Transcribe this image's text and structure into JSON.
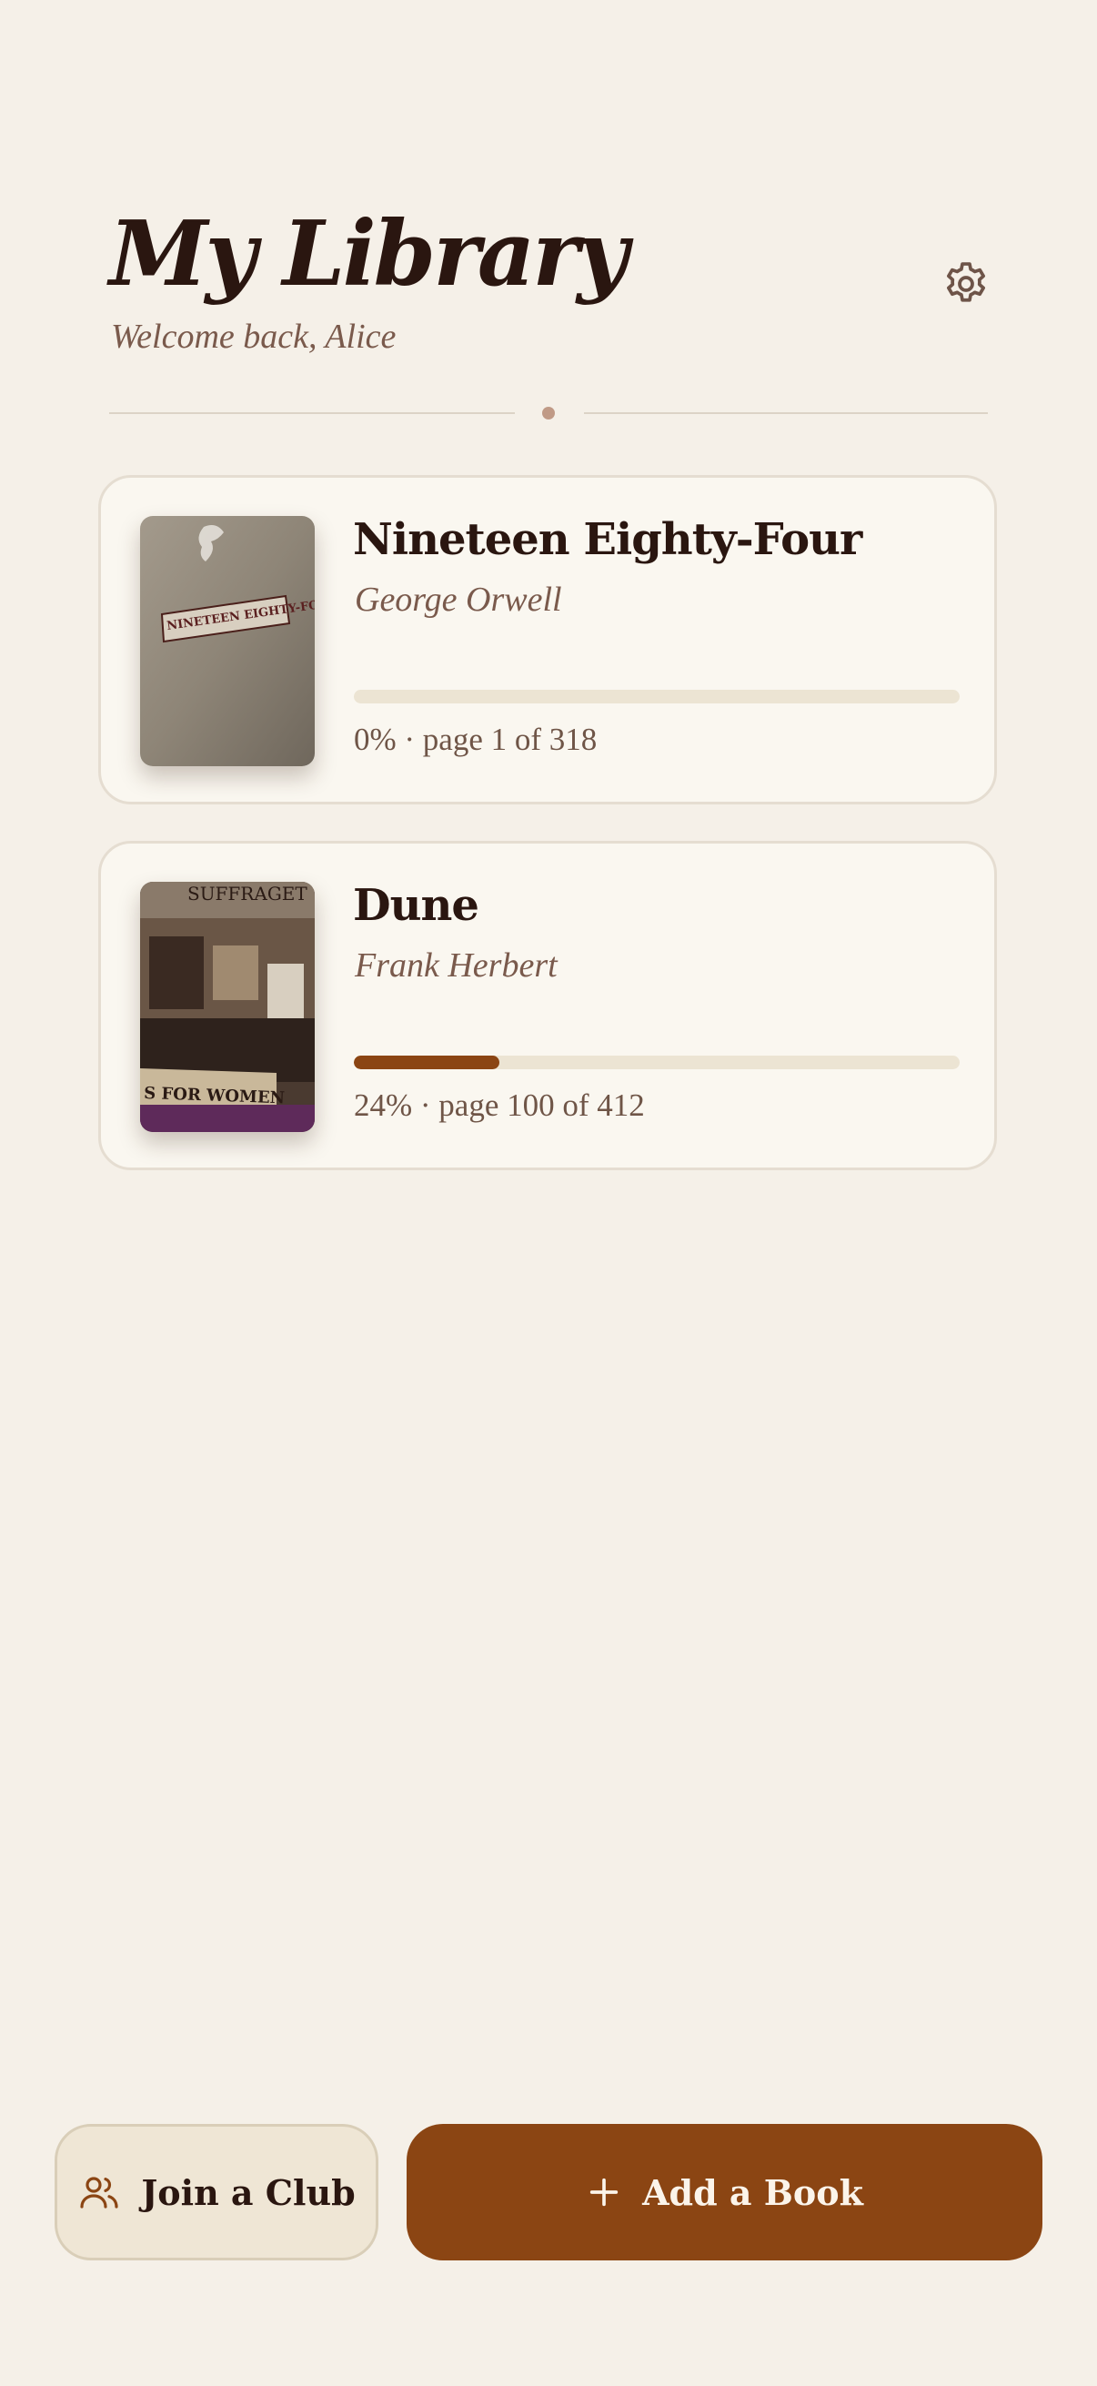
{
  "header": {
    "title": "My Library",
    "subtitle": "Welcome back, Alice",
    "settings_icon": "gear-icon"
  },
  "books": [
    {
      "title": "Nineteen Eighty-Four",
      "author": "George Orwell",
      "progress": 0,
      "progress_text": "0% · page 1 of 318",
      "cover_text": "NINETEEN EIGHTY-FOUR"
    },
    {
      "title": "Dune",
      "author": "Frank Herbert",
      "progress": 24,
      "progress_text": "24% · page 100 of 412",
      "cover_text_top": "SUFFRAGET",
      "cover_text_bottom": "S FOR WOMEN"
    }
  ],
  "actions": {
    "join_club": "Join a Club",
    "join_icon": "users-icon",
    "add_book": "Add a Book",
    "add_icon": "plus-icon"
  },
  "colors": {
    "background": "#f5f0e8",
    "accent": "#8b4513",
    "card": "#faf7f0",
    "text": "#2a1610",
    "muted": "#7a5a4c"
  }
}
